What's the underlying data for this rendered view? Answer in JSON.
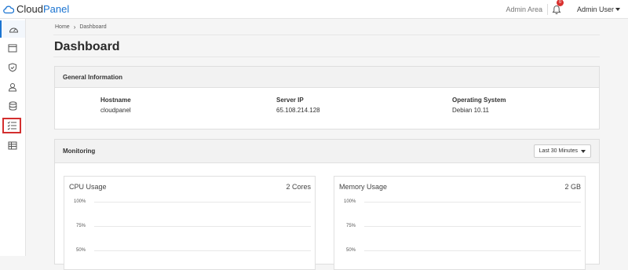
{
  "header": {
    "brand_cloud": "Cloud",
    "brand_panel": "Panel",
    "admin_area": "Admin Area",
    "notification_count": "0",
    "admin_user": "Admin User"
  },
  "sidebar": {
    "items": [
      {
        "icon": "dashboard-icon",
        "active": true
      },
      {
        "icon": "browser-window-icon"
      },
      {
        "icon": "shield-icon"
      },
      {
        "icon": "user-icon"
      },
      {
        "icon": "database-icon"
      },
      {
        "icon": "checklist-icon",
        "highlighted": true
      },
      {
        "icon": "table-icon"
      }
    ]
  },
  "breadcrumb": {
    "home": "Home",
    "current": "Dashboard"
  },
  "page": {
    "title": "Dashboard"
  },
  "general": {
    "title": "General Information",
    "hostname_label": "Hostname",
    "hostname_value": "cloudpanel",
    "server_ip_label": "Server IP",
    "server_ip_value": "65.108.214.128",
    "os_label": "Operating System",
    "os_value": "Debian 10.11"
  },
  "monitoring": {
    "title": "Monitoring",
    "range": "Last 30 Minutes",
    "cpu": {
      "title": "CPU Usage",
      "meta": "2 Cores",
      "ticks": [
        "100%",
        "75%",
        "50%"
      ]
    },
    "memory": {
      "title": "Memory Usage",
      "meta": "2 GB",
      "ticks": [
        "100%",
        "75%",
        "50%"
      ]
    }
  }
}
